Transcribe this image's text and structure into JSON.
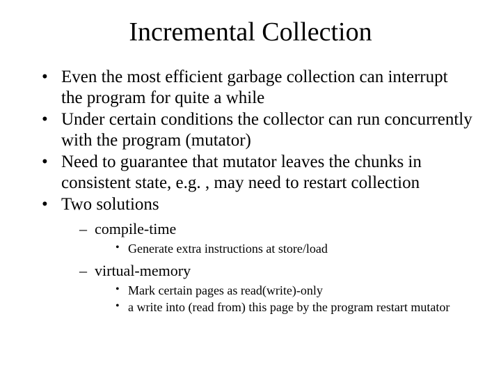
{
  "title": "Incremental Collection",
  "bullets": {
    "b1": "Even the most efficient garbage collection can interrupt the program for quite a while",
    "b2": "Under certain conditions the collector can run concurrently with the program (mutator)",
    "b3": "Need to guarantee that mutator leaves the chunks in consistent state, e.g. , may need to restart collection",
    "b4": "Two solutions",
    "s1": "compile-time",
    "s1a": "Generate extra instructions at store/load",
    "s2": "virtual-memory",
    "s2a": "Mark certain pages as read(write)-only",
    "s2b": "a write into (read from) this page by the program restart mutator"
  }
}
